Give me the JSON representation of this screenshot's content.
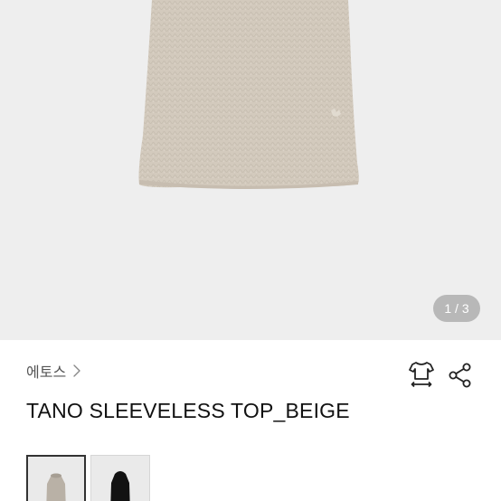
{
  "gallery": {
    "counter": "1 / 3"
  },
  "product": {
    "brand": "에토스",
    "title": "TANO SLEEVELESS TOP_BEIGE"
  },
  "actions": {
    "size_icon": "tshirt-size-icon",
    "share_icon": "share-icon"
  },
  "thumbnails": [
    {
      "color": "beige",
      "swatch": "#b9b1a6",
      "selected": true
    },
    {
      "color": "black",
      "swatch": "#121212",
      "selected": false
    }
  ],
  "colors": {
    "hero_background": "#eeeeee",
    "knit_beige": "#d3cabd"
  }
}
